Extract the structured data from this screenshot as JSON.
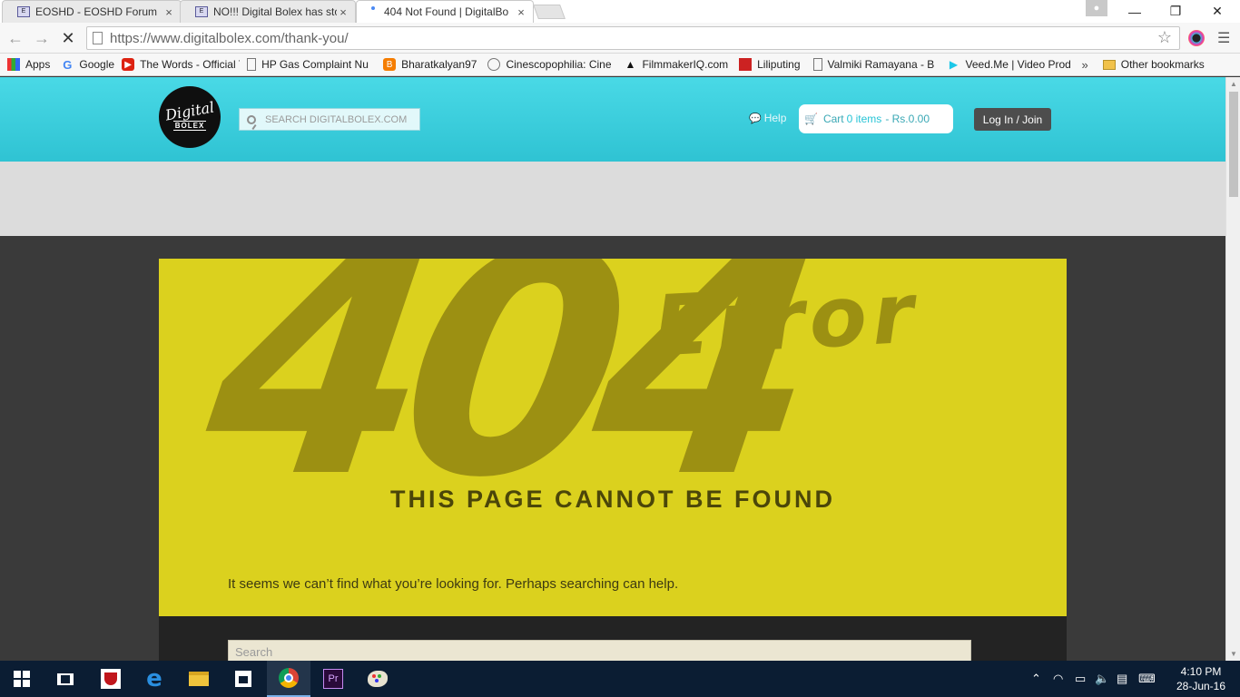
{
  "browser": {
    "tabs": [
      {
        "title": "EOSHD - EOSHD Forum",
        "favicon": "eoshd-icon",
        "active": false
      },
      {
        "title": "NO!!! Digital Bolex has sto",
        "favicon": "eoshd-icon",
        "active": false
      },
      {
        "title": "404 Not Found | DigitalBo",
        "favicon": "loading-spinner-icon",
        "active": true
      }
    ],
    "url_host": "https://www.digitalbolex.com",
    "url_path": "/thank-you/",
    "bookmarks": [
      {
        "label": "Apps",
        "icon": "apps-grid-icon"
      },
      {
        "label": "Google",
        "icon": "google-icon"
      },
      {
        "label": "The Words - Official T",
        "icon": "youtube-icon"
      },
      {
        "label": "HP Gas Complaint Nu",
        "icon": "page-icon"
      },
      {
        "label": "Bharatkalyan97",
        "icon": "blogger-icon"
      },
      {
        "label": "Cinescopophilia: Cine",
        "icon": "cinescopophilia-icon"
      },
      {
        "label": "FilmmakerIQ.com",
        "icon": "graduation-cap-icon"
      },
      {
        "label": "Liliputing",
        "icon": "liliputing-icon"
      },
      {
        "label": "Valmiki Ramayana - B",
        "icon": "page-icon"
      },
      {
        "label": "Veed.Me | Video Prod",
        "icon": "veed-play-icon"
      }
    ],
    "bookmarks_more": "»",
    "other_bookmarks": "Other bookmarks"
  },
  "site": {
    "logo_line1": "Digital",
    "logo_line2": "BOLEX",
    "search_placeholder": "SEARCH DIGITALBOLEX.COM",
    "help_label": "Help",
    "cart_label": "Cart",
    "cart_items": "0 items",
    "cart_price": "- Rs.0.00",
    "login_label": "Log In / Join"
  },
  "error": {
    "code": "404",
    "word": "Error",
    "headline": "THIS PAGE CANNOT BE FOUND",
    "message": "It seems we can’t find what you’re looking for. Perhaps searching can help.",
    "search_placeholder": "Search"
  },
  "colors": {
    "header_cyan": "#3fd2e0",
    "panel_yellow": "#dbd11e",
    "numeral_olive": "#9c9012",
    "taskbar_navy": "#0b1d33"
  },
  "taskbar": {
    "time": "4:10 PM",
    "date": "28-Jun-16",
    "pinned": [
      "mcafee-icon",
      "edge-icon",
      "file-explorer-icon",
      "store-icon",
      "chrome-icon",
      "premiere-icon",
      "paint-icon"
    ],
    "premiere_label": "Pr"
  }
}
